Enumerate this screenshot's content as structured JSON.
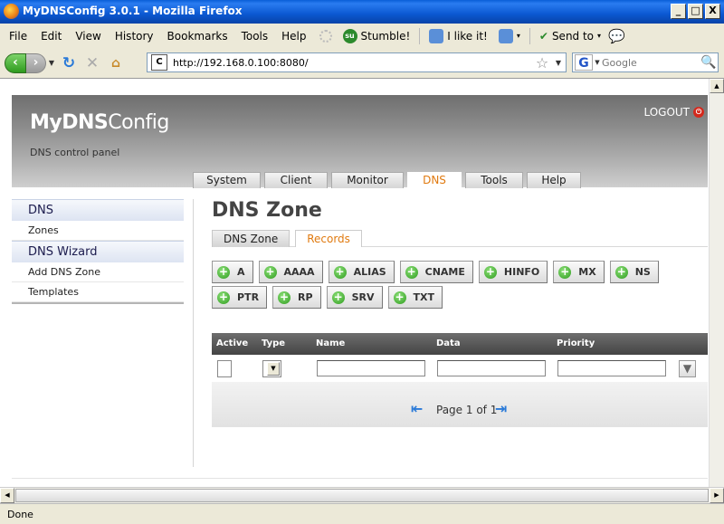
{
  "window": {
    "title": "MyDNSConfig 3.0.1 - Mozilla Firefox",
    "minimize": "_",
    "maximize": "□",
    "close": "X"
  },
  "menu": {
    "items": [
      "File",
      "Edit",
      "View",
      "History",
      "Bookmarks",
      "Tools",
      "Help"
    ],
    "stumble": "Stumble!",
    "ilike": "I like it!",
    "sendto": "Send to"
  },
  "nav": {
    "url": "http://192.168.0.100:8080/",
    "search_placeholder": "Google"
  },
  "app": {
    "brand_bold": "MyDNS",
    "brand_thin": "Config",
    "tagline": "DNS control panel",
    "logout": "LOGOUT",
    "tabs": [
      "System",
      "Client",
      "Monitor",
      "DNS",
      "Tools",
      "Help"
    ],
    "active_tab": "DNS"
  },
  "sidebar": {
    "section1": "DNS",
    "section1_items": [
      "Zones"
    ],
    "section2": "DNS Wizard",
    "section2_items": [
      "Add DNS Zone",
      "Templates"
    ]
  },
  "content": {
    "title": "DNS Zone",
    "subtabs": [
      "DNS Zone",
      "Records"
    ],
    "active_subtab": "Records",
    "record_buttons_row1": [
      "A",
      "AAAA",
      "ALIAS",
      "CNAME",
      "HINFO",
      "MX",
      "NS"
    ],
    "record_buttons_row2": [
      "PTR",
      "RP",
      "SRV",
      "TXT"
    ],
    "grid_columns": [
      "Active",
      "Type",
      "Name",
      "Data",
      "Priority"
    ],
    "pager_text": "Page 1 of 1"
  },
  "status": {
    "text": "Done"
  }
}
